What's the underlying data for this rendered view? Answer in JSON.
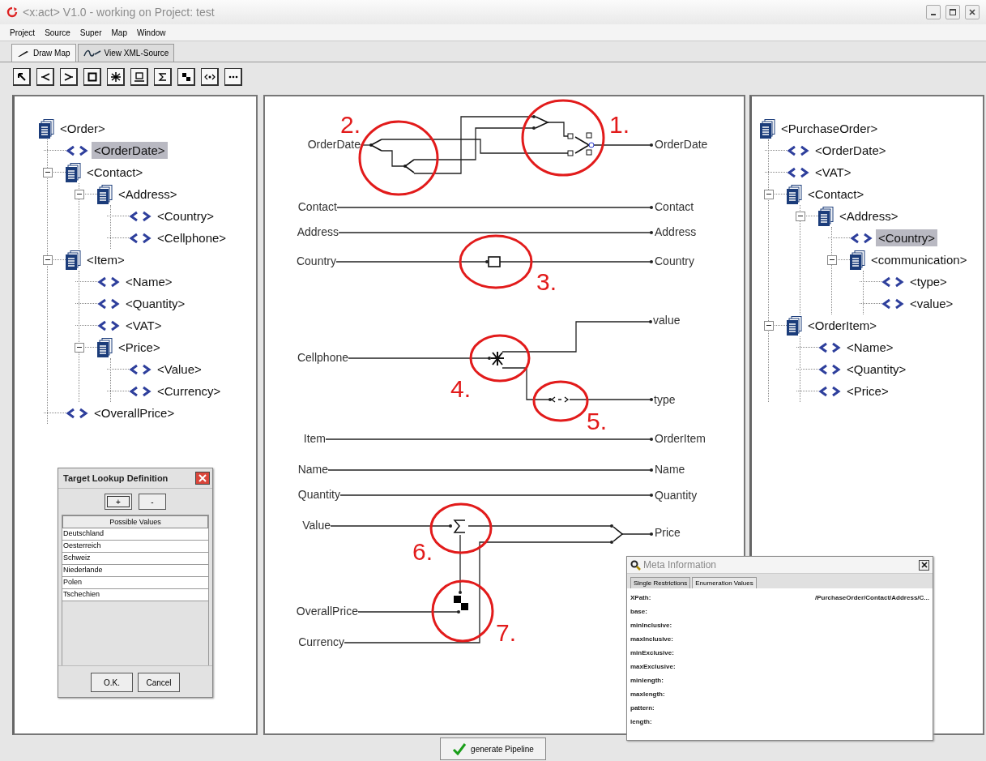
{
  "window": {
    "title": "<x:act> V1.0 - working on Project: test"
  },
  "menu": [
    "Project",
    "Source",
    "Super",
    "Map",
    "Window"
  ],
  "tabs": [
    {
      "label": "Draw Map",
      "selected": true
    },
    {
      "label": "View XML-Source",
      "selected": false
    }
  ],
  "source_tree": {
    "label": "<Order>",
    "kind": "group",
    "selected": false,
    "children": [
      {
        "label": "<OrderDate>",
        "kind": "leaf",
        "selected": true
      },
      {
        "label": "<Contact>",
        "kind": "group",
        "selected": false,
        "expanded": true,
        "children": [
          {
            "label": "<Address>",
            "kind": "group",
            "selected": false,
            "expanded": true,
            "children": [
              {
                "label": "<Country>",
                "kind": "leaf",
                "selected": false
              },
              {
                "label": "<Cellphone>",
                "kind": "leaf",
                "selected": false
              }
            ]
          }
        ]
      },
      {
        "label": "<Item>",
        "kind": "group",
        "selected": false,
        "expanded": true,
        "children": [
          {
            "label": "<Name>",
            "kind": "leaf",
            "selected": false
          },
          {
            "label": "<Quantity>",
            "kind": "leaf",
            "selected": false
          },
          {
            "label": "<VAT>",
            "kind": "leaf",
            "selected": false
          },
          {
            "label": "<Price>",
            "kind": "group",
            "selected": false,
            "expanded": true,
            "children": [
              {
                "label": "<Value>",
                "kind": "leaf",
                "selected": false
              },
              {
                "label": "<Currency>",
                "kind": "leaf",
                "selected": false
              }
            ]
          }
        ]
      },
      {
        "label": "<OverallPrice>",
        "kind": "leaf",
        "selected": false
      }
    ]
  },
  "mapping": {
    "sources": [
      "OrderDate",
      "Contact",
      "Address",
      "Country",
      "Cellphone",
      "Item",
      "Name",
      "Quantity",
      "Value",
      "OverallPrice",
      "Currency"
    ],
    "targets": [
      "OrderDate",
      "Contact",
      "Address",
      "Country",
      "value",
      "type",
      "OrderItem",
      "Name",
      "Quantity",
      "Price"
    ],
    "markers": [
      "1.",
      "2.",
      "3.",
      "4.",
      "5.",
      "6.",
      "7."
    ]
  },
  "target_tree": {
    "label": "<PurchaseOrder>",
    "kind": "group",
    "selected": false,
    "children": [
      {
        "label": "<OrderDate>",
        "kind": "leaf",
        "selected": false
      },
      {
        "label": "<VAT>",
        "kind": "leaf",
        "selected": false
      },
      {
        "label": "<Contact>",
        "kind": "group",
        "selected": false,
        "expanded": true,
        "children": [
          {
            "label": "<Address>",
            "kind": "group",
            "selected": false,
            "expanded": true,
            "children": [
              {
                "label": "<Country>",
                "kind": "leaf",
                "selected": true
              },
              {
                "label": "<communication>",
                "kind": "group",
                "selected": false,
                "expanded": true,
                "children": [
                  {
                    "label": "<type>",
                    "kind": "leaf",
                    "selected": false
                  },
                  {
                    "label": "<value>",
                    "kind": "leaf",
                    "selected": false
                  }
                ]
              }
            ]
          }
        ]
      },
      {
        "label": "<OrderItem>",
        "kind": "group",
        "selected": false,
        "expanded": true,
        "children": [
          {
            "label": "<Name>",
            "kind": "leaf",
            "selected": false
          },
          {
            "label": "<Quantity>",
            "kind": "leaf",
            "selected": false
          },
          {
            "label": "<Price>",
            "kind": "leaf",
            "selected": false
          }
        ]
      }
    ]
  },
  "lookup_dialog": {
    "title": "Target Lookup Definition",
    "buttons": [
      "+",
      "-"
    ],
    "column": "Possible Values",
    "values": [
      "Deutschland",
      "Oesterreich",
      "Schweiz",
      "Niederlande",
      "Polen",
      "Tschechien"
    ],
    "actions": [
      "O.K.",
      "Cancel"
    ]
  },
  "meta_dialog": {
    "title": "Meta Information",
    "tabs": [
      {
        "label": "Single Restrictions",
        "selected": true
      },
      {
        "label": "Enumeration Values",
        "selected": false
      }
    ],
    "fields": [
      {
        "label": "XPath:",
        "value": "/PurchaseOrder/Contact/Address/C..."
      },
      {
        "label": "base:"
      },
      {
        "label": "minInclusive:"
      },
      {
        "label": "maxInclusive:"
      },
      {
        "label": "minExclusive:"
      },
      {
        "label": "maxExclusive:"
      },
      {
        "label": "minlength:"
      },
      {
        "label": "maxlength:"
      },
      {
        "label": "pattern:"
      },
      {
        "label": "length:"
      }
    ]
  },
  "footer_button": "generate Pipeline"
}
